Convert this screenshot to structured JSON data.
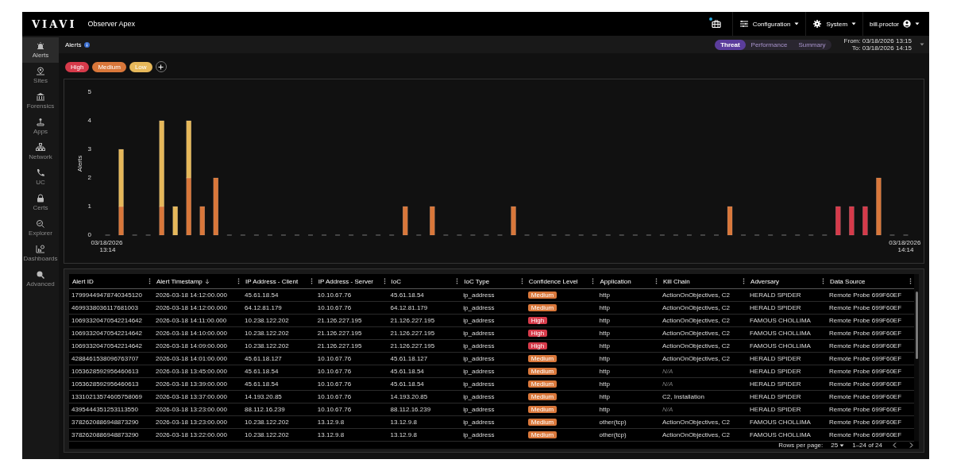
{
  "brand": {
    "logo": "VIAVI",
    "app_name": "Observer Apex"
  },
  "top_menu": [
    {
      "label": "Configuration"
    },
    {
      "label": "System"
    },
    {
      "label": "bill.proctor"
    }
  ],
  "notification": {
    "unread": true
  },
  "sidebar": {
    "items": [
      {
        "label": "Alerts",
        "selected": true
      },
      {
        "label": "Sites",
        "selected": false
      },
      {
        "label": "Forensics",
        "selected": false
      },
      {
        "label": "Apps",
        "selected": false
      },
      {
        "label": "Network",
        "selected": false
      },
      {
        "label": "UC",
        "selected": false
      },
      {
        "label": "Certs",
        "selected": false
      },
      {
        "label": "Explorer",
        "selected": false
      },
      {
        "label": "Dashboards",
        "selected": false
      },
      {
        "label": "Advanced",
        "selected": false
      }
    ]
  },
  "page_title": "Alerts",
  "tabs": [
    {
      "label": "Threat",
      "selected": true
    },
    {
      "label": "Performance",
      "selected": false
    },
    {
      "label": "Summary",
      "selected": false
    }
  ],
  "time_range": {
    "from": "From: 03/18/2026 13:15",
    "to": "To: 03/18/2026 14:15"
  },
  "chart": {
    "chart_data": {
      "type": "bar",
      "stacked": true,
      "ylabel": "Alerts",
      "ylim": [
        0,
        5
      ],
      "yticks": [
        0,
        1,
        2,
        3,
        4,
        5
      ],
      "categories": [
        "03/18/2026 13:14",
        null,
        null,
        null,
        null,
        null,
        null,
        null,
        null,
        null,
        null,
        null,
        null,
        null,
        null,
        null,
        null,
        null,
        null,
        null,
        null,
        null,
        null,
        null,
        null,
        null,
        null,
        null,
        null,
        null,
        null,
        null,
        null,
        null,
        null,
        null,
        null,
        null,
        null,
        null,
        null,
        null,
        null,
        null,
        null,
        null,
        null,
        null,
        null,
        null,
        null,
        null,
        null,
        null,
        null,
        null,
        null,
        null,
        null,
        "03/18/2026 14:14"
      ],
      "series": [
        {
          "name": "High",
          "color": "#d63a4a",
          "values": [
            0,
            0,
            0,
            0,
            0,
            0,
            0,
            0,
            0,
            0,
            0,
            0,
            0,
            0,
            0,
            0,
            0,
            0,
            0,
            0,
            0,
            0,
            0,
            0,
            0,
            0,
            0,
            0,
            0,
            0,
            0,
            0,
            0,
            0,
            0,
            0,
            0,
            0,
            0,
            0,
            0,
            0,
            0,
            0,
            0,
            0,
            0,
            0,
            0,
            0,
            0,
            0,
            0,
            0,
            1,
            1,
            1,
            0,
            0,
            0
          ]
        },
        {
          "name": "Medium",
          "color": "#d9773a",
          "values": [
            0,
            1,
            0,
            0,
            1,
            0,
            2,
            1,
            2,
            0,
            0,
            0,
            0,
            0,
            0,
            0,
            0,
            0,
            0,
            0,
            0,
            0,
            1,
            0,
            1,
            0,
            0,
            0,
            0,
            0,
            1,
            0,
            0,
            0,
            0,
            0,
            0,
            0,
            0,
            0,
            0,
            0,
            0,
            0,
            0,
            0,
            1,
            0,
            0,
            0,
            0,
            0,
            0,
            0,
            0,
            0,
            0,
            2,
            0,
            0
          ]
        },
        {
          "name": "Low",
          "color": "#e6b85a",
          "values": [
            0,
            2,
            0,
            0,
            3,
            1,
            2,
            0,
            0,
            0,
            0,
            0,
            0,
            0,
            0,
            0,
            0,
            0,
            0,
            0,
            0,
            0,
            0,
            0,
            0,
            0,
            0,
            0,
            0,
            0,
            0,
            0,
            0,
            0,
            0,
            0,
            0,
            0,
            0,
            0,
            0,
            0,
            0,
            0,
            0,
            0,
            0,
            0,
            0,
            0,
            0,
            0,
            0,
            0,
            0,
            0,
            0,
            0,
            0,
            0
          ]
        }
      ]
    }
  },
  "table": {
    "columns": [
      {
        "label": "Alert ID",
        "sorted": false
      },
      {
        "label": "Alert Timestamp",
        "sorted": true
      },
      {
        "label": "IP Address - Client",
        "sorted": false
      },
      {
        "label": "IP Address - Server",
        "sorted": false
      },
      {
        "label": "IoC",
        "sorted": false
      },
      {
        "label": "IoC Type",
        "sorted": false
      },
      {
        "label": "Confidence Level",
        "sorted": false
      },
      {
        "label": "Application",
        "sorted": false
      },
      {
        "label": "Kill Chain",
        "sorted": false
      },
      {
        "label": "Adversary",
        "sorted": false
      },
      {
        "label": "Data Source",
        "sorted": false
      }
    ],
    "rows": [
      {
        "alert_id": "17999449478740345120",
        "timestamp": "2026-03-18 14:12:00.000",
        "ip_client": "45.61.18.54",
        "ip_server": "10.10.67.76",
        "ioc": "45.61.18.54",
        "ioc_type": "ip_address",
        "confidence": {
          "label": "Medium",
          "color": "#d9773a"
        },
        "application": "http",
        "kill_chain": "ActionOnObjectives, C2",
        "kill_chain_missing": false,
        "adversary": "HERALD SPIDER",
        "data_source": "Remote Probe 699F60EF"
      },
      {
        "alert_id": "4699338036117681003",
        "timestamp": "2026-03-18 14:12:00.000",
        "ip_client": "64.12.81.179",
        "ip_server": "10.10.67.76",
        "ioc": "64.12.81.179",
        "ioc_type": "ip_address",
        "confidence": {
          "label": "Medium",
          "color": "#d9773a"
        },
        "application": "http",
        "kill_chain": "ActionOnObjectives, C2",
        "kill_chain_missing": false,
        "adversary": "HERALD SPIDER",
        "data_source": "Remote Probe 699F60EF"
      },
      {
        "alert_id": "10693320470542214642",
        "timestamp": "2026-03-18 14:11:00.000",
        "ip_client": "10.238.122.202",
        "ip_server": "21.126.227.195",
        "ioc": "21.126.227.195",
        "ioc_type": "ip_address",
        "confidence": {
          "label": "High",
          "color": "#d63a4a"
        },
        "application": "http",
        "kill_chain": "ActionOnObjectives, C2",
        "kill_chain_missing": false,
        "adversary": "FAMOUS CHOLLIMA",
        "data_source": "Remote Probe 699F60EF"
      },
      {
        "alert_id": "10693320470542214642",
        "timestamp": "2026-03-18 14:10:00.000",
        "ip_client": "10.238.122.202",
        "ip_server": "21.126.227.195",
        "ioc": "21.126.227.195",
        "ioc_type": "ip_address",
        "confidence": {
          "label": "High",
          "color": "#d63a4a"
        },
        "application": "http",
        "kill_chain": "ActionOnObjectives, C2",
        "kill_chain_missing": false,
        "adversary": "FAMOUS CHOLLIMA",
        "data_source": "Remote Probe 699F60EF"
      },
      {
        "alert_id": "10693320470542214642",
        "timestamp": "2026-03-18 14:09:00.000",
        "ip_client": "10.238.122.202",
        "ip_server": "21.126.227.195",
        "ioc": "21.126.227.195",
        "ioc_type": "ip_address",
        "confidence": {
          "label": "High",
          "color": "#d63a4a"
        },
        "application": "http",
        "kill_chain": "ActionOnObjectives, C2",
        "kill_chain_missing": false,
        "adversary": "FAMOUS CHOLLIMA",
        "data_source": "Remote Probe 699F60EF"
      },
      {
        "alert_id": "4288461538096763707",
        "timestamp": "2026-03-18 14:01:00.000",
        "ip_client": "45.61.18.127",
        "ip_server": "10.10.67.76",
        "ioc": "45.61.18.127",
        "ioc_type": "ip_address",
        "confidence": {
          "label": "Medium",
          "color": "#d9773a"
        },
        "application": "http",
        "kill_chain": "ActionOnObjectives, C2",
        "kill_chain_missing": false,
        "adversary": "HERALD SPIDER",
        "data_source": "Remote Probe 699F60EF"
      },
      {
        "alert_id": "1053628592956460613",
        "timestamp": "2026-03-18 13:45:00.000",
        "ip_client": "45.61.18.54",
        "ip_server": "10.10.67.76",
        "ioc": "45.61.18.54",
        "ioc_type": "ip_address",
        "confidence": {
          "label": "Medium",
          "color": "#d9773a"
        },
        "application": "http",
        "kill_chain": "N/A",
        "kill_chain_missing": true,
        "adversary": "HERALD SPIDER",
        "data_source": "Remote Probe 699F60EF"
      },
      {
        "alert_id": "1053628592956460613",
        "timestamp": "2026-03-18 13:39:00.000",
        "ip_client": "45.61.18.54",
        "ip_server": "10.10.67.76",
        "ioc": "45.61.18.54",
        "ioc_type": "ip_address",
        "confidence": {
          "label": "Medium",
          "color": "#d9773a"
        },
        "application": "http",
        "kill_chain": "N/A",
        "kill_chain_missing": true,
        "adversary": "HERALD SPIDER",
        "data_source": "Remote Probe 699F60EF"
      },
      {
        "alert_id": "13310213574605758069",
        "timestamp": "2026-03-18 13:37:00.000",
        "ip_client": "14.193.20.85",
        "ip_server": "10.10.67.76",
        "ioc": "14.193.20.85",
        "ioc_type": "ip_address",
        "confidence": {
          "label": "Medium",
          "color": "#d9773a"
        },
        "application": "http",
        "kill_chain": "C2, Installation",
        "kill_chain_missing": false,
        "adversary": "HERALD SPIDER",
        "data_source": "Remote Probe 699F60EF"
      },
      {
        "alert_id": "4395444351253113550",
        "timestamp": "2026-03-18 13:23:00.000",
        "ip_client": "88.112.16.239",
        "ip_server": "10.10.67.76",
        "ioc": "88.112.16.239",
        "ioc_type": "ip_address",
        "confidence": {
          "label": "Medium",
          "color": "#d9773a"
        },
        "application": "http",
        "kill_chain": "N/A",
        "kill_chain_missing": true,
        "adversary": "HERALD SPIDER",
        "data_source": "Remote Probe 699F60EF"
      },
      {
        "alert_id": "3782620886948873290",
        "timestamp": "2026-03-18 13:23:00.000",
        "ip_client": "10.238.122.202",
        "ip_server": "13.12.9.8",
        "ioc": "13.12.9.8",
        "ioc_type": "ip_address",
        "confidence": {
          "label": "Medium",
          "color": "#d9773a"
        },
        "application": "other(tcp)",
        "kill_chain": "ActionOnObjectives, C2",
        "kill_chain_missing": false,
        "adversary": "FAMOUS CHOLLIMA",
        "data_source": "Remote Probe 699F60EF"
      },
      {
        "alert_id": "3782620886948873290",
        "timestamp": "2026-03-18 13:22:00.000",
        "ip_client": "10.238.122.202",
        "ip_server": "13.12.9.8",
        "ioc": "13.12.9.8",
        "ioc_type": "ip_address",
        "confidence": {
          "label": "Medium",
          "color": "#d9773a"
        },
        "application": "other(tcp)",
        "kill_chain": "ActionOnObjectives, C2",
        "kill_chain_missing": false,
        "adversary": "FAMOUS CHOLLIMA",
        "data_source": "Remote Probe 699F60EF"
      }
    ],
    "footer": {
      "rows_per_page_label": "Rows per page:",
      "rows_per_page": "25",
      "range": "1–24 of 24"
    }
  }
}
